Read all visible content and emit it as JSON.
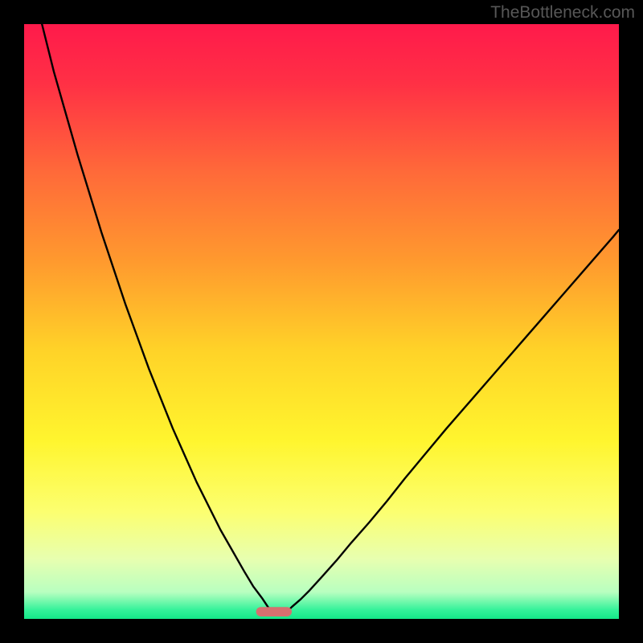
{
  "watermark": "TheBottleneck.com",
  "chart_data": {
    "type": "line",
    "title": "",
    "xlabel": "",
    "ylabel": "",
    "xlim": [
      0,
      100
    ],
    "ylim": [
      0,
      100
    ],
    "background": {
      "type": "vertical-gradient",
      "stops": [
        {
          "pos": 0.0,
          "color": "#ff1a4b"
        },
        {
          "pos": 0.1,
          "color": "#ff3045"
        },
        {
          "pos": 0.25,
          "color": "#ff6a39"
        },
        {
          "pos": 0.4,
          "color": "#ff9a2e"
        },
        {
          "pos": 0.55,
          "color": "#ffd328"
        },
        {
          "pos": 0.7,
          "color": "#fff52e"
        },
        {
          "pos": 0.82,
          "color": "#fcff70"
        },
        {
          "pos": 0.9,
          "color": "#e7ffb0"
        },
        {
          "pos": 0.955,
          "color": "#b8ffc0"
        },
        {
          "pos": 0.985,
          "color": "#34f29a"
        },
        {
          "pos": 1.0,
          "color": "#14e889"
        }
      ]
    },
    "marker": {
      "x": 42,
      "y": 1.2,
      "width": 6,
      "height": 1.6,
      "color": "#d6706f"
    },
    "series": [
      {
        "name": "left-curve",
        "color": "#000000",
        "x": [
          3,
          5,
          7,
          9,
          11,
          13,
          15,
          17,
          19,
          21,
          23,
          25,
          27,
          29,
          31,
          33,
          35,
          37,
          38.5,
          40,
          41,
          42
        ],
        "y": [
          100,
          92,
          85,
          78,
          71.5,
          65,
          59,
          53,
          47.5,
          42,
          37,
          32,
          27.5,
          23,
          19,
          15,
          11.5,
          8,
          5.5,
          3.5,
          2,
          1
        ]
      },
      {
        "name": "right-curve",
        "color": "#000000",
        "x": [
          44,
          45,
          46.5,
          48,
          50,
          52.5,
          55,
          58,
          61,
          64,
          67.5,
          71,
          75,
          79,
          83,
          87,
          91,
          95,
          99,
          100
        ],
        "y": [
          1,
          2,
          3.3,
          4.8,
          7,
          9.8,
          12.8,
          16.2,
          19.8,
          23.6,
          27.8,
          32,
          36.6,
          41.2,
          45.8,
          50.4,
          55,
          59.6,
          64.2,
          65.4
        ]
      }
    ]
  }
}
